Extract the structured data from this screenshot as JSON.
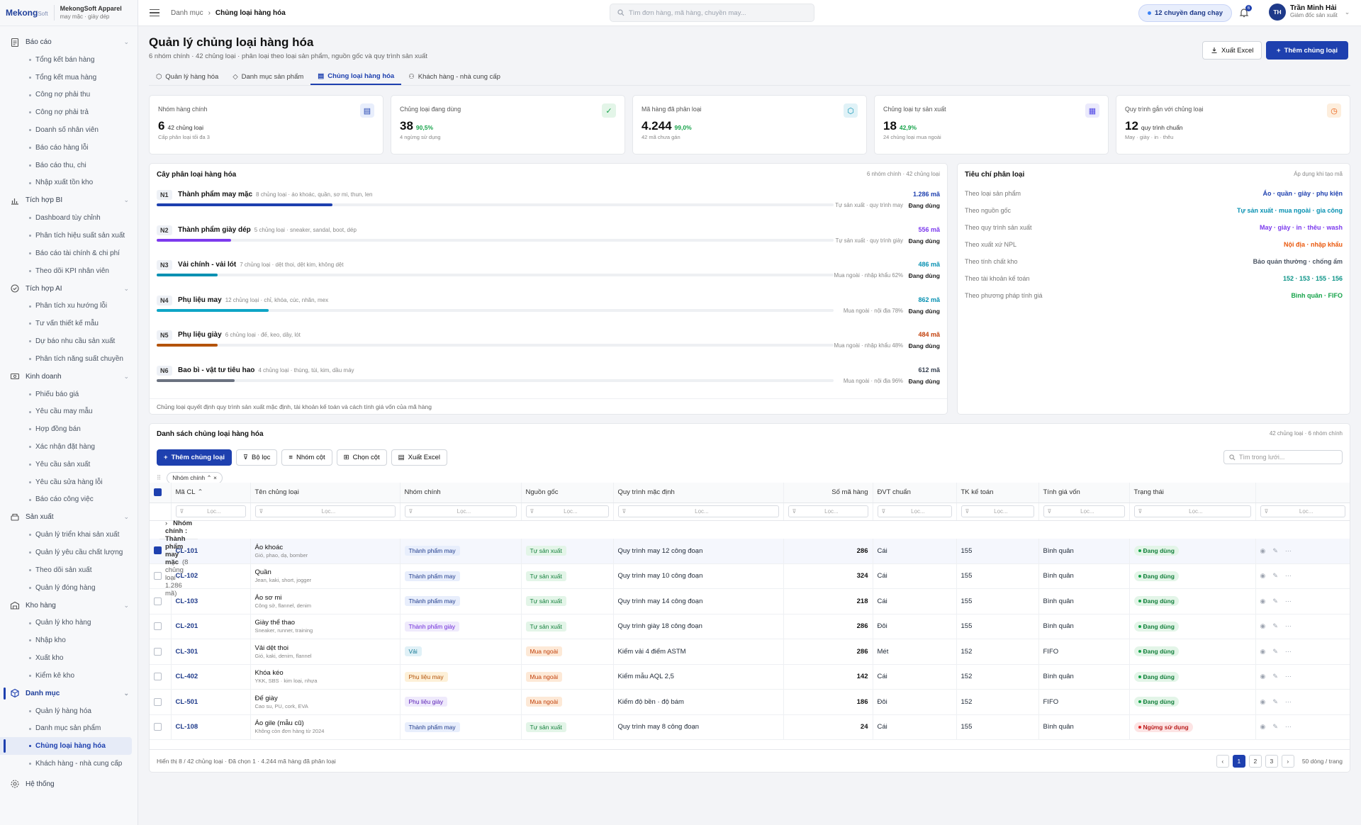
{
  "sidebar": {
    "logo_main": "Mekong",
    "logo_sub": "Soft",
    "company_name": "MekongSoft Apparel",
    "company_sub": "may mặc · giày dép",
    "groups": [
      {
        "label": "Báo cáo",
        "icon": "report-icon",
        "items": [
          "Tổng kết bán hàng",
          "Tổng kết mua hàng",
          "Công nợ phải thu",
          "Công nợ phải trả",
          "Doanh số nhân viên",
          "Báo cáo hàng lỗi",
          "Báo cáo thu, chi",
          "Nhập xuất tồn kho"
        ]
      },
      {
        "label": "Tích hợp BI",
        "icon": "chart-icon",
        "items": [
          "Dashboard tùy chỉnh",
          "Phân tích hiệu suất sản xuất",
          "Báo cáo tài chính & chi phí",
          "Theo dõi KPI nhân viên"
        ]
      },
      {
        "label": "Tích hợp AI",
        "icon": "ai-icon",
        "items": [
          "Phân tích xu hướng lỗi",
          "Tư vấn thiết kế mẫu",
          "Dự báo nhu cầu sản xuất",
          "Phân tích năng suất chuyền"
        ]
      },
      {
        "label": "Kinh doanh",
        "icon": "business-icon",
        "items": [
          "Phiếu báo giá",
          "Yêu cầu may mẫu",
          "Hợp đồng bán",
          "Xác nhận đặt hàng",
          "Yêu cầu sản xuất",
          "Yêu cầu sửa hàng lỗi",
          "Báo cáo công việc"
        ]
      },
      {
        "label": "Sản xuất",
        "icon": "production-icon",
        "items": [
          "Quản lý triển khai sản xuất",
          "Quản lý yêu cầu chất lượng",
          "Theo dõi sản xuất",
          "Quản lý đóng hàng"
        ]
      },
      {
        "label": "Kho hàng",
        "icon": "warehouse-icon",
        "items": [
          "Quản lý kho hàng",
          "Nhập kho",
          "Xuất kho",
          "Kiểm kê kho"
        ]
      },
      {
        "label": "Danh mục",
        "icon": "catalog-icon",
        "items": [
          "Quản lý hàng hóa",
          "Danh mục sản phẩm",
          "Chủng loại hàng hóa",
          "Khách hàng - nhà cung cấp"
        ]
      }
    ],
    "system_label": "Hệ thống"
  },
  "topbar": {
    "breadcrumb_root": "Danh mục",
    "breadcrumb_current": "Chủng loại hàng hóa",
    "search_placeholder": "Tìm đơn hàng, mã hàng, chuyền may...",
    "running_badge": "12 chuyền đang chạy",
    "notif_count": "6",
    "user_initials": "TH",
    "user_name": "Trần Minh Hải",
    "user_role": "Giám đốc sản xuất"
  },
  "page": {
    "title": "Quản lý chủng loại hàng hóa",
    "subtitle": "6 nhóm chính · 42 chủng loại · phân loại theo loại sản phẩm, nguồn gốc và quy trình sản xuất",
    "export_label": "Xuất Excel",
    "add_label": "Thêm chủng loại",
    "tabs": [
      "Quản lý hàng hóa",
      "Danh mục sản phẩm",
      "Chủng loại hàng hóa",
      "Khách hàng - nhà cung cấp"
    ]
  },
  "kpis": [
    {
      "title": "Nhóm hàng chính",
      "value": "6",
      "unit": "42 chủng loại",
      "pct": "",
      "hint": "Cấp phân loại tối đa 3",
      "icon": "document-icon",
      "color": "#1e40af",
      "bg": "#e8eefc"
    },
    {
      "title": "Chủng loại đang dùng",
      "value": "38",
      "unit": "",
      "pct": "90,5%",
      "hint": "4 ngừng sử dụng",
      "icon": "check-circle-icon",
      "color": "#16a34a",
      "bg": "#e3f5e8"
    },
    {
      "title": "Mã hàng đã phân loại",
      "value": "4.244",
      "unit": "",
      "pct": "99,0%",
      "hint": "42 mã chưa gán",
      "icon": "box-icon",
      "color": "#0891b2",
      "bg": "#e0f2f7"
    },
    {
      "title": "Chủng loại tự sản xuất",
      "value": "18",
      "unit": "",
      "pct": "42,9%",
      "hint": "24 chủng loại mua ngoài",
      "icon": "factory-icon",
      "color": "#4f46e5",
      "bg": "#ebeafc"
    },
    {
      "title": "Quy trình gắn với chủng loại",
      "value": "12",
      "unit": "quy trình chuẩn",
      "pct": "",
      "hint": "May · giày · in · thêu",
      "icon": "clock-icon",
      "color": "#ea580c",
      "bg": "#fdeedd"
    }
  ],
  "tree": {
    "title": "Cây phân loại hàng hóa",
    "meta": "6 nhóm chính · 42 chủng loại",
    "footer": "Chủng loại quyết định quy trình sản xuất mặc định, tài khoản kế toán và cách tính giá vốn của mã hàng",
    "rows": [
      {
        "code": "N1",
        "name": "Thành phẩm may mặc",
        "desc": "8 chủng loại · áo khoác, quần, sơ mi, thun, len",
        "count": "1.286 mã",
        "count_color": "#1e40af",
        "fill": 0.26,
        "fill_color": "#1e40af",
        "note": "Tự sản xuất · quy trình may",
        "status": "Đang dùng"
      },
      {
        "code": "N2",
        "name": "Thành phẩm giày dép",
        "desc": "5 chủng loại · sneaker, sandal, boot, dép",
        "count": "556 mã",
        "count_color": "#7c3aed",
        "fill": 0.11,
        "fill_color": "#7c3aed",
        "note": "Tự sản xuất · quy trình giày",
        "status": "Đang dùng"
      },
      {
        "code": "N3",
        "name": "Vải chính - vải lót",
        "desc": "7 chủng loại · dệt thoi, dệt kim, không dệt",
        "count": "486 mã",
        "count_color": "#0891b2",
        "fill": 0.09,
        "fill_color": "#0891b2",
        "note": "Mua ngoài · nhập khẩu 62%",
        "status": "Đang dùng"
      },
      {
        "code": "N4",
        "name": "Phụ liệu may",
        "desc": "12 chủng loại · chỉ, khóa, cúc, nhãn, mex",
        "count": "862 mã",
        "count_color": "#0891b2",
        "fill": 0.165,
        "fill_color": "#0ea5c6",
        "note": "Mua ngoài · nội địa 78%",
        "status": "Đang dùng"
      },
      {
        "code": "N5",
        "name": "Phụ liệu giày",
        "desc": "6 chủng loại · đế, keo, dây, lót",
        "count": "484 mã",
        "count_color": "#c2410c",
        "fill": 0.09,
        "fill_color": "#b45309",
        "note": "Mua ngoài · nhập khẩu 48%",
        "status": "Đang dùng"
      },
      {
        "code": "N6",
        "name": "Bao bì - vật tư tiêu hao",
        "desc": "4 chủng loại · thùng, túi, kim, dầu máy",
        "count": "612 mã",
        "count_color": "#374151",
        "fill": 0.115,
        "fill_color": "#6b7280",
        "note": "Mua ngoài · nội địa 96%",
        "status": "Đang dùng"
      }
    ]
  },
  "criteria": {
    "title": "Tiêu chí phân loại",
    "meta": "Áp dụng khi tạo mã",
    "rows": [
      {
        "key": "Theo loại sản phẩm",
        "value": "Áo · quần · giày · phụ kiện",
        "color": "#1e40af"
      },
      {
        "key": "Theo nguồn gốc",
        "value": "Tự sản xuất · mua ngoài · gia công",
        "color": "#0891b2"
      },
      {
        "key": "Theo quy trình sản xuất",
        "value": "May · giày · in · thêu · wash",
        "color": "#7c3aed"
      },
      {
        "key": "Theo xuất xứ NPL",
        "value": "Nội địa · nhập khẩu",
        "color": "#ea580c"
      },
      {
        "key": "Theo tính chất kho",
        "value": "Bảo quản thường · chống ẩm",
        "color": "#4b5563"
      },
      {
        "key": "Theo tài khoản kế toán",
        "value": "152 · 153 · 155 · 156",
        "color": "#0d9488"
      },
      {
        "key": "Theo phương pháp tính giá",
        "value": "Bình quân · FIFO",
        "color": "#16a34a"
      }
    ]
  },
  "grid": {
    "title": "Danh sách chủng loại hàng hóa",
    "meta": "42 chủng loại · 6 nhóm chính",
    "toolbar": {
      "add": "Thêm chủng loại",
      "filter": "Bộ lọc",
      "group": "Nhóm cột",
      "columns": "Chọn cột",
      "export": "Xuất Excel"
    },
    "search_placeholder": "Tìm trong lưới...",
    "group_chip": "Nhóm chính",
    "filter_placeholder": "Lọc...",
    "columns": [
      "Mã CL",
      "Tên chủng loại",
      "Nhóm chính",
      "Nguồn gốc",
      "Quy trình mặc định",
      "Số mã hàng",
      "ĐVT chuẩn",
      "TK kế toán",
      "Tính giá vốn",
      "Trạng thái"
    ],
    "group_row": {
      "label": "Nhóm chính",
      "name": "Thành phẩm may mặc",
      "meta": "(8 chủng loại · 1.286 mã)"
    },
    "rows": [
      {
        "code": "CL-101",
        "name": "Áo khoác",
        "desc": "Gió, phao, dạ, bomber",
        "group": "Thành phẩm may",
        "gclass": "p-may",
        "origin": "Tự sản xuất",
        "oclass": "s-tu",
        "process": "Quy trình may 12 công đoạn",
        "count": "286",
        "unit": "Cái",
        "acct": "155",
        "cost": "Bình quân",
        "status": "Đang dùng",
        "sclass": "st-on",
        "checked": true
      },
      {
        "code": "CL-102",
        "name": "Quần",
        "desc": "Jean, kaki, short, jogger",
        "group": "Thành phẩm may",
        "gclass": "p-may",
        "origin": "Tự sản xuất",
        "oclass": "s-tu",
        "process": "Quy trình may 10 công đoạn",
        "count": "324",
        "unit": "Cái",
        "acct": "155",
        "cost": "Bình quân",
        "status": "Đang dùng",
        "sclass": "st-on",
        "checked": false
      },
      {
        "code": "CL-103",
        "name": "Áo sơ mi",
        "desc": "Công sở, flannel, denim",
        "group": "Thành phẩm may",
        "gclass": "p-may",
        "origin": "Tự sản xuất",
        "oclass": "s-tu",
        "process": "Quy trình may 14 công đoạn",
        "count": "218",
        "unit": "Cái",
        "acct": "155",
        "cost": "Bình quân",
        "status": "Đang dùng",
        "sclass": "st-on",
        "checked": false
      },
      {
        "code": "CL-201",
        "name": "Giày thể thao",
        "desc": "Sneaker, runner, training",
        "group": "Thành phẩm giày",
        "gclass": "p-giay",
        "origin": "Tự sản xuất",
        "oclass": "s-tu",
        "process": "Quy trình giày 18 công đoạn",
        "count": "286",
        "unit": "Đôi",
        "acct": "155",
        "cost": "Bình quân",
        "status": "Đang dùng",
        "sclass": "st-on",
        "checked": false
      },
      {
        "code": "CL-301",
        "name": "Vải dệt thoi",
        "desc": "Gió, kaki, denim, flannel",
        "group": "Vải",
        "gclass": "p-vai",
        "origin": "Mua ngoài",
        "oclass": "s-mua",
        "process": "Kiểm vải 4 điểm ASTM",
        "count": "286",
        "unit": "Mét",
        "acct": "152",
        "cost": "FIFO",
        "status": "Đang dùng",
        "sclass": "st-on",
        "checked": false
      },
      {
        "code": "CL-402",
        "name": "Khóa kéo",
        "desc": "YKK, SBS · kim loại, nhựa",
        "group": "Phụ liệu may",
        "gclass": "p-phu",
        "origin": "Mua ngoài",
        "oclass": "s-mua",
        "process": "Kiểm mẫu AQL 2,5",
        "count": "142",
        "unit": "Cái",
        "acct": "152",
        "cost": "Bình quân",
        "status": "Đang dùng",
        "sclass": "st-on",
        "checked": false
      },
      {
        "code": "CL-501",
        "name": "Đế giày",
        "desc": "Cao su, PU, cork, EVA",
        "group": "Phụ liệu giày",
        "gclass": "p-pg",
        "origin": "Mua ngoài",
        "oclass": "s-mua",
        "process": "Kiểm độ bền · độ bám",
        "count": "186",
        "unit": "Đôi",
        "acct": "152",
        "cost": "FIFO",
        "status": "Đang dùng",
        "sclass": "st-on",
        "checked": false
      },
      {
        "code": "CL-108",
        "name": "Áo gile (mẫu cũ)",
        "desc": "Không còn đơn hàng từ 2024",
        "group": "Thành phẩm may",
        "gclass": "p-may",
        "origin": "Tự sản xuất",
        "oclass": "s-tu",
        "process": "Quy trình may 8 công đoạn",
        "count": "24",
        "unit": "Cái",
        "acct": "155",
        "cost": "Bình quân",
        "status": "Ngừng sử dụng",
        "sclass": "st-off",
        "checked": false
      }
    ],
    "footer": "Hiển thị 8 / 42 chủng loại · Đã chọn 1 · 4.244 mã hàng đã phân loại",
    "pages": [
      "1",
      "2",
      "3"
    ],
    "page_size": "50 dòng / trang"
  }
}
